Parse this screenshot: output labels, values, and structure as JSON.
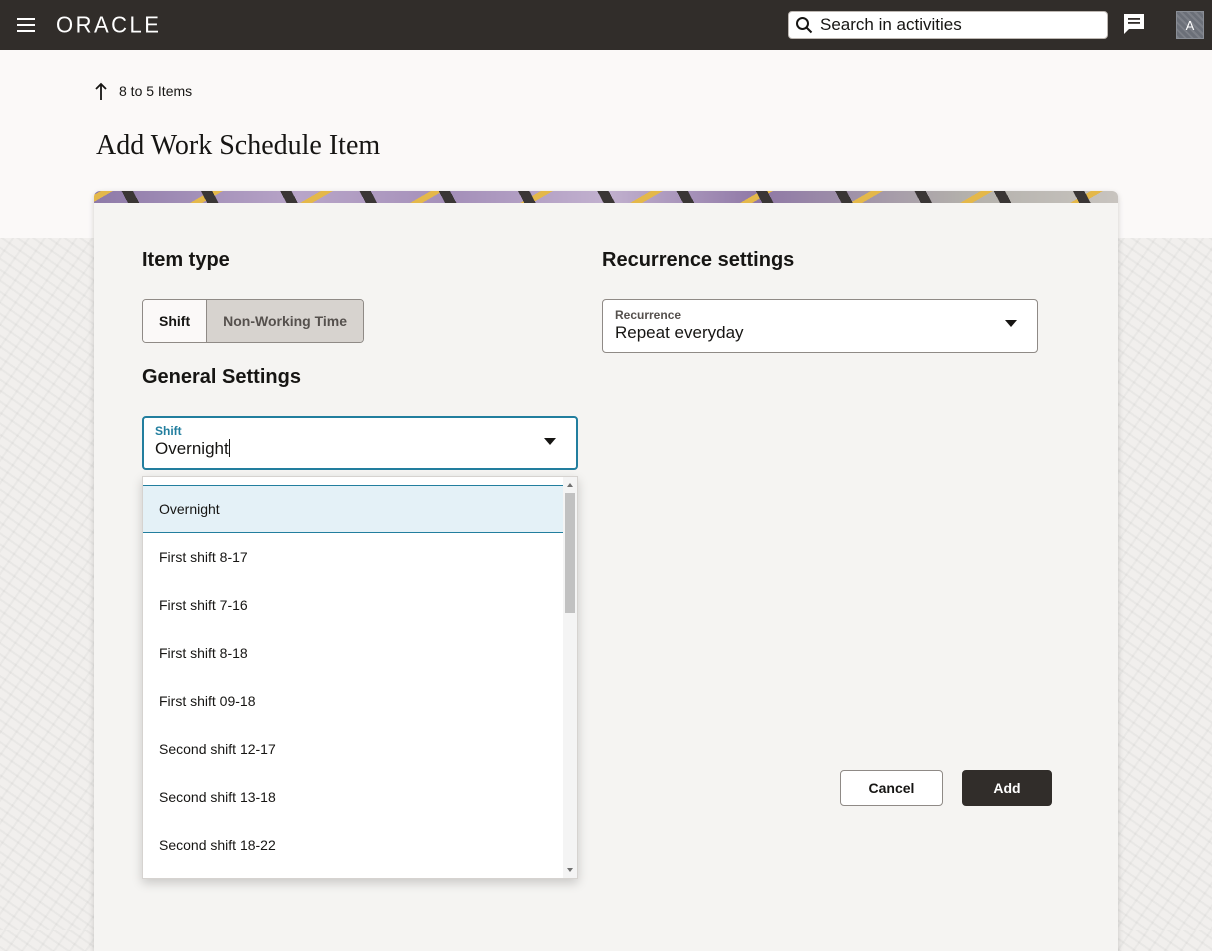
{
  "header": {
    "logo_text": "ORACLE",
    "search_placeholder": "Search in activities",
    "avatar_initial": "A"
  },
  "breadcrumb": {
    "back_label": "8 to 5 Items"
  },
  "page": {
    "title": "Add Work Schedule Item"
  },
  "item_type": {
    "heading": "Item type",
    "options": [
      "Shift",
      "Non-Working Time"
    ],
    "selected": "Shift"
  },
  "general_settings": {
    "heading": "General Settings",
    "shift_field": {
      "label": "Shift",
      "value": "Overnight"
    }
  },
  "recurrence_settings": {
    "heading": "Recurrence settings",
    "recurrence_field": {
      "label": "Recurrence",
      "value": "Repeat everyday"
    }
  },
  "shift_dropdown": {
    "options": [
      "Overnight",
      "First shift 8-17",
      "First shift 7-16",
      "First shift 8-18",
      "First shift 09-18",
      "Second shift 12-17",
      "Second shift 13-18",
      "Second shift 18-22"
    ],
    "highlighted": "Overnight"
  },
  "actions": {
    "cancel_label": "Cancel",
    "add_label": "Add"
  },
  "colors": {
    "topbar_bg": "#312d2a",
    "focus_accent": "#227e9e",
    "highlight_bg": "#e4f1f7",
    "primary_button_bg": "#312d2a"
  }
}
